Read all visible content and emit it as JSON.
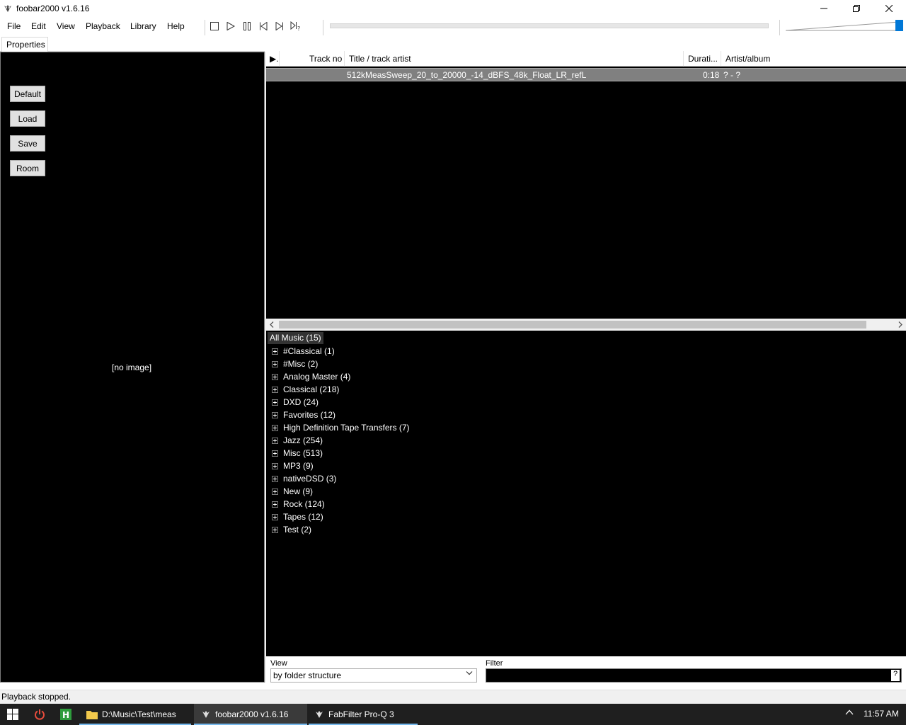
{
  "window": {
    "title": "foobar2000 v1.6.16"
  },
  "menu": [
    "File",
    "Edit",
    "View",
    "Playback",
    "Library",
    "Help"
  ],
  "toolbar": {
    "buttons": [
      "stop-icon",
      "play-icon",
      "pause-icon",
      "previous-icon",
      "next-icon",
      "random-icon"
    ]
  },
  "playback": {
    "volume": 1.0
  },
  "tabs": {
    "properties": "Properties"
  },
  "left_panel": {
    "buttons": [
      "Default",
      "Load",
      "Save",
      "Room"
    ],
    "no_image": "[no image]"
  },
  "playlist": {
    "columns": [
      {
        "key": "playing",
        "label": "▶."
      },
      {
        "key": "track_no",
        "label": "Track no"
      },
      {
        "key": "title",
        "label": "Title / track artist"
      },
      {
        "key": "duration",
        "label": "Durati..."
      },
      {
        "key": "artist_album",
        "label": "Artist/album"
      }
    ],
    "rows": [
      {
        "title": "512kMeasSweep_20_to_20000_-14_dBFS_48k_Float_LR_refL",
        "duration": "0:18",
        "artist_album": "? - ?"
      }
    ]
  },
  "library": {
    "root": "All Music (15)",
    "nodes": [
      "#Classical (1)",
      "#Misc (2)",
      "Analog Master (4)",
      "Classical (218)",
      "DXD (24)",
      "Favorites (12)",
      "High Definition Tape Transfers (7)",
      "Jazz (254)",
      "Misc (513)",
      "MP3 (9)",
      "nativeDSD (3)",
      "New (9)",
      "Rock (124)",
      "Tapes (12)",
      "Test (2)"
    ]
  },
  "filterbar": {
    "view_label": "View",
    "view_value": "by folder structure",
    "filter_label": "Filter",
    "filter_help": "?"
  },
  "status": {
    "text": "Playback stopped."
  },
  "taskbar": {
    "items": [
      {
        "label": "D:\\Music\\Test\\meas",
        "icon": "folder-icon"
      },
      {
        "label": "foobar2000 v1.6.16",
        "icon": "foobar-icon"
      },
      {
        "label": "FabFilter Pro-Q 3",
        "icon": "foobar-icon"
      }
    ],
    "clock": "11:57 AM"
  }
}
